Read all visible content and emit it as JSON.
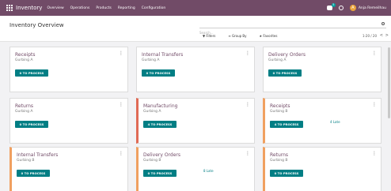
{
  "topbar": {
    "app_name": "Inventory",
    "menu": [
      "Overview",
      "Operations",
      "Products",
      "Reporting",
      "Configuration"
    ],
    "chat_badge": "5",
    "avatar_letter": "A",
    "user_name": "Anja Remeilhau"
  },
  "control_panel": {
    "breadcrumb": "Inventory Overview",
    "search_placeholder": "Search...",
    "filters": "Filters",
    "group_by": "Group By",
    "favorites": "Favorites",
    "pager": "1-20 / 20",
    "prev": "<",
    "next": ">"
  },
  "cards": [
    {
      "title": "Receipts",
      "sub": "Gurbing A",
      "button": "0 TO PROCESS",
      "late": "",
      "accent": ""
    },
    {
      "title": "Internal Transfers",
      "sub": "Gurbing A",
      "button": "0 TO PROCESS",
      "late": "",
      "accent": ""
    },
    {
      "title": "Delivery Orders",
      "sub": "Gurbing A",
      "button": "0 TO PROCESS",
      "late": "",
      "accent": ""
    },
    {
      "title": "Returns",
      "sub": "Gurbing A",
      "button": "0 TO PROCESS",
      "late": "",
      "accent": ""
    },
    {
      "title": "Manufacturing",
      "sub": "Gurbing A",
      "button": "4 TO PROCESS",
      "late": "",
      "accent": "red"
    },
    {
      "title": "Receipts",
      "sub": "Gurbing B",
      "button": "4 TO PROCESS",
      "late": "4 Late",
      "accent": "orange"
    },
    {
      "title": "Internal Transfers",
      "sub": "Gurbing B",
      "button": "0 TO PROCESS",
      "late": "",
      "accent": "orange"
    },
    {
      "title": "Delivery Orders",
      "sub": "Gurbing B",
      "button": "0 TO PROCESS",
      "late": "8 Late",
      "accent": "orange"
    },
    {
      "title": "Returns",
      "sub": "Gurbing B",
      "button": "0 TO PROCESS",
      "late": "",
      "accent": "orange"
    }
  ],
  "colors": {
    "brand": "#714b67",
    "button": "#017e84",
    "accent_orange": "#f0a060",
    "accent_red": "#e06a55"
  }
}
